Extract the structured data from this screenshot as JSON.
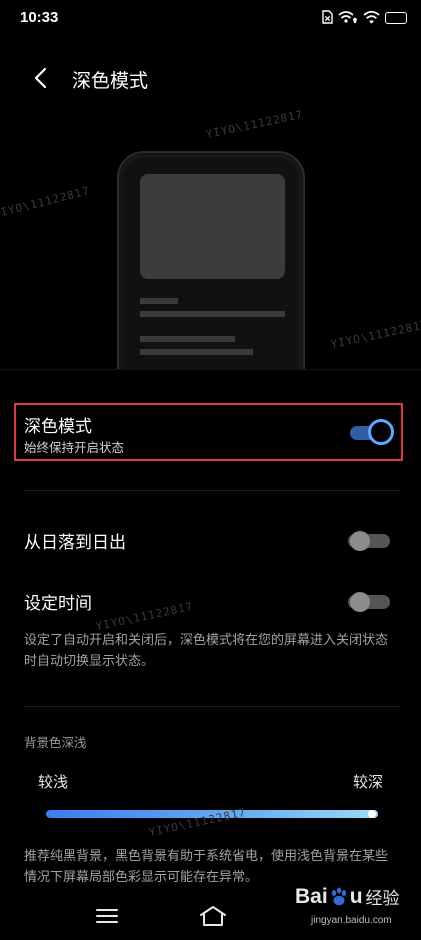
{
  "status_bar": {
    "time": "10:33",
    "battery": "80",
    "battery_level": 0.8,
    "icons": [
      "sim-card-icon",
      "wifi-calling-icon",
      "wifi-icon",
      "battery-icon"
    ]
  },
  "header": {
    "back_icon": "chevron-left-icon",
    "title": "深色模式"
  },
  "dark_mode": {
    "title": "深色模式",
    "subtitle": "始终保持开启状态",
    "enabled": true,
    "highlight_color": "#e23a3a"
  },
  "schedule": {
    "sunset_label": "从日落到日出",
    "sunset_enabled": false,
    "custom_time_label": "设定时间",
    "custom_time_enabled": false,
    "note": "设定了自动开启和关闭后，深色模式将在您的屏幕进入关闭状态时自动切换显示状态。"
  },
  "background": {
    "section_label": "背景色深浅",
    "min_label": "较浅",
    "max_label": "较深",
    "level": 1.0,
    "note": "推荐纯黑背景，黑色背景有助于系统省电，使用浅色背景在某些情况下屏幕局部色彩显示可能存在异常。"
  },
  "nav_bar": {
    "icons": [
      "menu-icon",
      "home-icon"
    ]
  },
  "watermark": {
    "text": "YIYO\\11122817",
    "source_brand": "Baidu",
    "source_cn": "经验",
    "source_url": "jingyan.baidu.com"
  },
  "colors": {
    "accent": "#5ea6ff",
    "toggle_on_track": "#2f5fa0",
    "background": "#000000"
  }
}
